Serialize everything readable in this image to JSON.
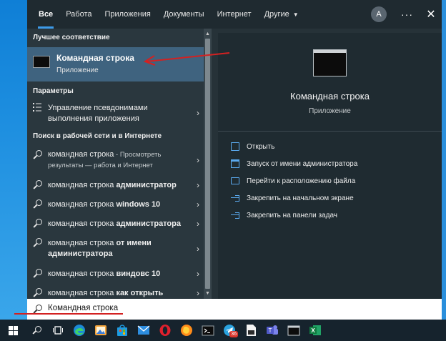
{
  "tabs": [
    {
      "label": "Все",
      "active": true
    },
    {
      "label": "Работа"
    },
    {
      "label": "Приложения"
    },
    {
      "label": "Документы"
    },
    {
      "label": "Интернет"
    },
    {
      "label": "Другие"
    }
  ],
  "top_right": {
    "avatar_letter": "A",
    "more": "···",
    "close": "✕"
  },
  "sections": {
    "best_match": "Лучшее соответствие",
    "settings": "Параметры",
    "web": "Поиск в рабочей сети и в Интернете"
  },
  "best_match": {
    "title": "Командная строка",
    "subtitle": "Приложение",
    "icon": "cmd-icon"
  },
  "settings_item": {
    "line1": "Управление псевдонимами",
    "line2": "выполнения приложения",
    "icon": "list-icon"
  },
  "web_items": [
    {
      "normal": "командная строка",
      "dim": " - Просмотреть",
      "dim2": "результаты — работа и Интернет"
    },
    {
      "normal": "командная строка ",
      "bold": "администратор"
    },
    {
      "normal": "командная строка ",
      "bold": "windows 10"
    },
    {
      "normal": "командная строка ",
      "bold": "администратора"
    },
    {
      "normal": "командная строка ",
      "bold": "от имени",
      "bold2": "администратора"
    },
    {
      "normal": "командная строка ",
      "bold": "виндовс 10"
    },
    {
      "normal": "командная строка ",
      "bold": "как открыть"
    }
  ],
  "preview": {
    "title": "Командная строка",
    "subtitle": "Приложение",
    "actions": [
      {
        "label": "Открыть",
        "icon": "open-icon"
      },
      {
        "label": "Запуск от имени администратора",
        "icon": "admin-window-icon"
      },
      {
        "label": "Перейти к расположению файла",
        "icon": "file-location-icon"
      },
      {
        "label": "Закрепить на начальном экране",
        "icon": "pin-icon"
      },
      {
        "label": "Закрепить на панели задач",
        "icon": "pin-icon"
      }
    ]
  },
  "search": {
    "value": "Командная строка"
  },
  "taskbar": {
    "items": [
      "windows-start-icon",
      "search-icon",
      "task-view-icon",
      "edge-icon",
      "photos-icon",
      "store-icon",
      "mail-icon",
      "opera-icon",
      "firefox-icon",
      "terminal-icon",
      "telegram-icon",
      "file-icon",
      "teams-icon",
      "cmd-icon",
      "excel-icon"
    ],
    "telegram_badge": "36"
  },
  "colors": {
    "accent": "#3d9be9",
    "selected": "#3f637f",
    "annotation": "#d32121"
  }
}
